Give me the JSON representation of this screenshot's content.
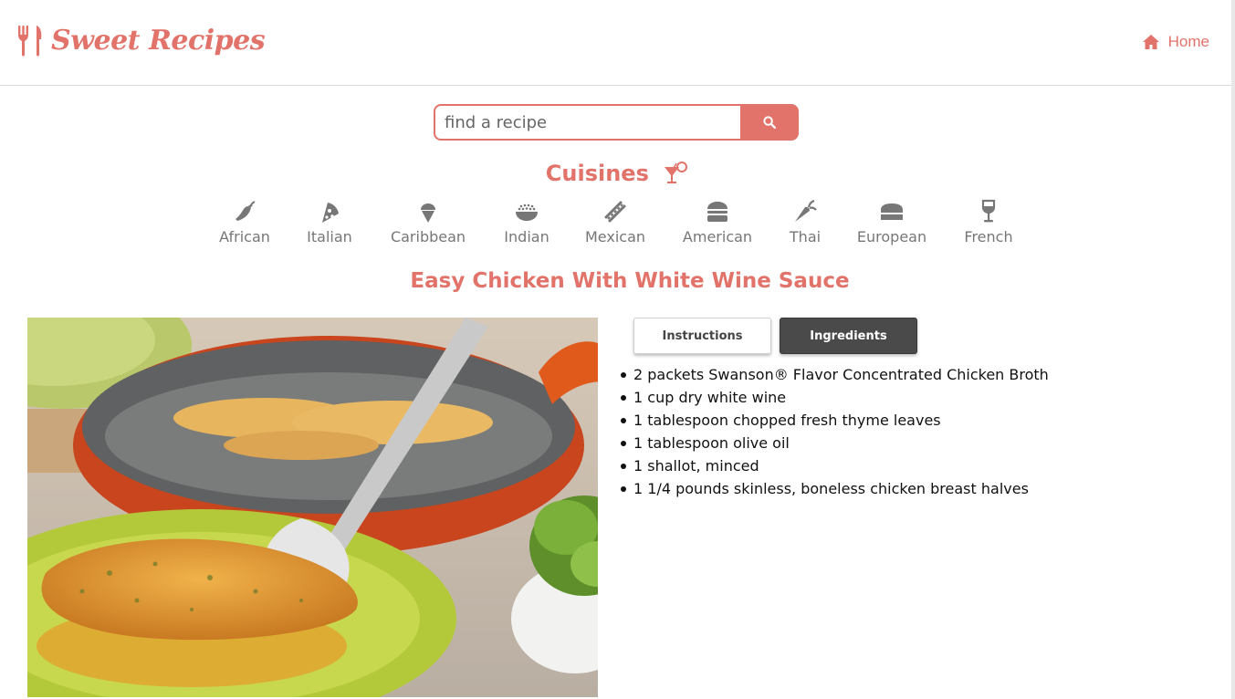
{
  "header": {
    "brand": "Sweet Recipes",
    "home_label": "Home"
  },
  "search": {
    "placeholder": "find a recipe"
  },
  "cuisines": {
    "title": "Cuisines",
    "items": [
      {
        "label": "African",
        "icon": "chili-pepper-icon"
      },
      {
        "label": "Italian",
        "icon": "pizza-slice-icon"
      },
      {
        "label": "Caribbean",
        "icon": "ice-cream-icon"
      },
      {
        "label": "Indian",
        "icon": "rice-bowl-icon"
      },
      {
        "label": "Mexican",
        "icon": "hotdog-icon"
      },
      {
        "label": "American",
        "icon": "hamburger-icon"
      },
      {
        "label": "Thai",
        "icon": "carrot-icon"
      },
      {
        "label": "European",
        "icon": "bread-loaf-icon"
      },
      {
        "label": "French",
        "icon": "wine-glass-icon"
      }
    ]
  },
  "recipe": {
    "title": "Easy Chicken With White Wine Sauce",
    "image_alt": "Chicken with white wine sauce on a green plate",
    "tabs": {
      "instructions": "Instructions",
      "ingredients": "Ingredients",
      "active": "ingredients"
    },
    "ingredients": [
      "2 packets Swanson® Flavor Concentrated Chicken Broth",
      "1 cup dry white wine",
      "1 tablespoon chopped fresh thyme leaves",
      "1 tablespoon olive oil",
      "1 shallot, minced",
      "1 1/4 pounds skinless, boneless chicken breast halves"
    ]
  },
  "colors": {
    "accent": "#e2736a",
    "muted": "#777777",
    "tab_active": "#4a4a4a"
  }
}
